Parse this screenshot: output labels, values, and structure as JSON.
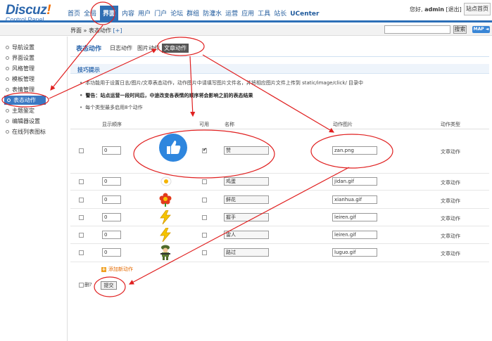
{
  "header": {
    "logo_main": "Discuz",
    "logo_exclaim": "!",
    "logo_sub": "Control Panel",
    "nav": [
      "首页",
      "全局",
      "界面",
      "内容",
      "用户",
      "门户",
      "论坛",
      "群组",
      "防灌水",
      "运营",
      "应用",
      "工具",
      "站长",
      "UCenter"
    ],
    "active_nav": "界面",
    "user_greeting": "您好,",
    "user_name": "admin",
    "logout": "[退出]",
    "site_home": "站点首页"
  },
  "subbar": {
    "breadcrumb": "界面 » 表态动作",
    "add": "[+]",
    "search_value": "",
    "search_button": "搜索",
    "map_button": "MAP ◄"
  },
  "sidebar": {
    "items": [
      "导航设置",
      "界面设置",
      "风格管理",
      "模板管理",
      "表情管理",
      "表态动作",
      "主题鉴定",
      "编辑器设置",
      "在线列表图标"
    ],
    "active": "表态动作"
  },
  "tabs": {
    "main": "表态动作",
    "items": [
      "日志动作",
      "图片动作",
      "文章动作"
    ],
    "selected": "文章动作"
  },
  "tips": {
    "title": "技巧提示",
    "lines": [
      "本功能用于设置日志/图片/文章表态动作，动作图片中请填写图片文件名，并将相应图片文件上传到 static/image/click/ 目录中",
      "警告：站点运营一段时间后，中途改变各表情的顺序将会影响之前的表态结果",
      "每个类型最多启用8个动作"
    ]
  },
  "table": {
    "headers": [
      "显示顺序",
      "可用",
      "名称",
      "动作图片",
      "动作类型"
    ],
    "rows": [
      {
        "order": "0",
        "enabled": true,
        "name": "赞",
        "image": "zan.png",
        "type": "文章动作",
        "icon": "thumbs-up-icon"
      },
      {
        "order": "0",
        "enabled": false,
        "name": "鸡蛋",
        "image": "jidan.gif",
        "type": "文章动作",
        "icon": "egg-icon"
      },
      {
        "order": "0",
        "enabled": false,
        "name": "鲜花",
        "image": "xianhua.gif",
        "type": "文章动作",
        "icon": "flower-icon"
      },
      {
        "order": "0",
        "enabled": false,
        "name": "握手",
        "image": "leiren.gif",
        "type": "文章动作",
        "icon": "lightning-icon"
      },
      {
        "order": "0",
        "enabled": false,
        "name": "雷人",
        "image": "leiren.gif",
        "type": "文章动作",
        "icon": "lightning-icon"
      },
      {
        "order": "0",
        "enabled": false,
        "name": "路过",
        "image": "luguo.gif",
        "type": "文章动作",
        "icon": "soldier-icon"
      }
    ],
    "add_action": "添加新动作",
    "delete_label": "删?",
    "submit": "提交"
  },
  "colors": {
    "brand": "#2b66ac",
    "annotation": "#e02020",
    "like_circle": "#2e86de"
  }
}
